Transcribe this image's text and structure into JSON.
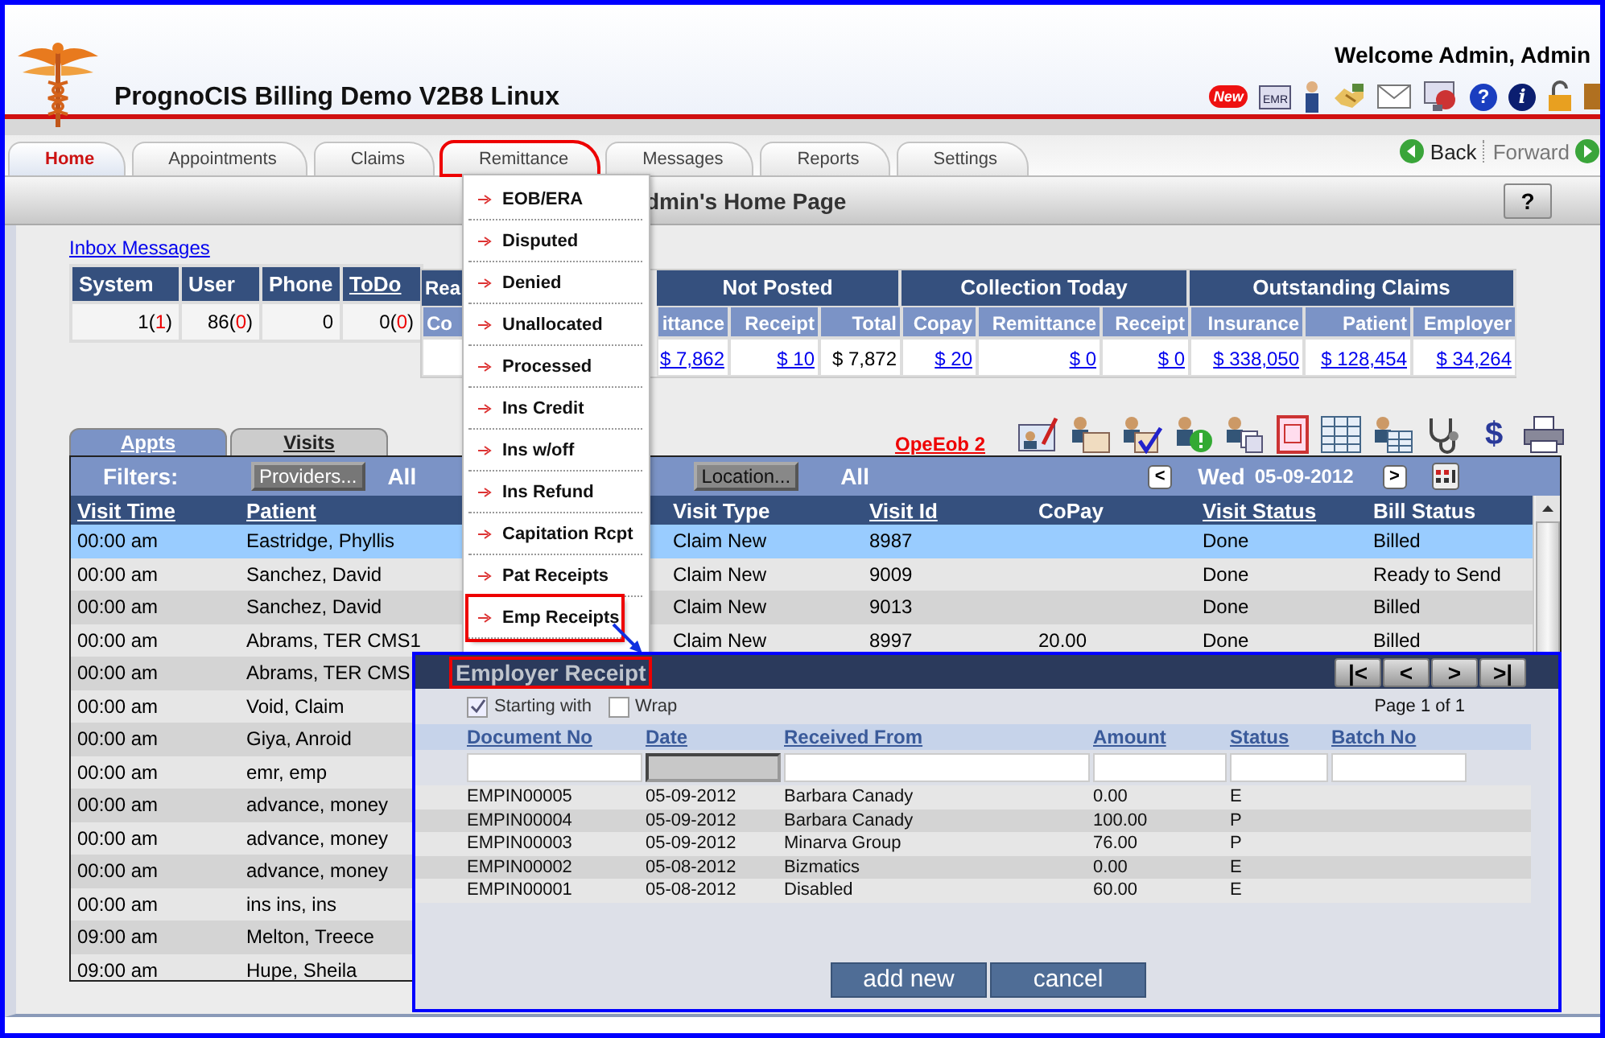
{
  "app": {
    "title": "PrognoCIS Billing Demo V2B8 Linux",
    "welcome": "Welcome Admin, Admin"
  },
  "header_icons": [
    {
      "kind": "badge",
      "text": "New"
    },
    {
      "kind": "emr",
      "text": "EMR"
    },
    {
      "kind": "person"
    },
    {
      "kind": "hands"
    },
    {
      "kind": "mail"
    },
    {
      "kind": "monitor"
    },
    {
      "kind": "help",
      "text": "?"
    },
    {
      "kind": "info",
      "text": "i"
    },
    {
      "kind": "lock"
    },
    {
      "kind": "exit"
    }
  ],
  "tabs": [
    {
      "label": "Home",
      "selected": true,
      "highlighted": false
    },
    {
      "label": "Appointments",
      "selected": false,
      "highlighted": false
    },
    {
      "label": "Claims",
      "selected": false,
      "highlighted": false
    },
    {
      "label": "Remittance",
      "selected": false,
      "highlighted": true
    },
    {
      "label": "Messages",
      "selected": false,
      "highlighted": false
    },
    {
      "label": "Reports",
      "selected": false,
      "highlighted": false
    },
    {
      "label": "Settings",
      "selected": false,
      "highlighted": false
    }
  ],
  "nav": {
    "back": "Back",
    "forward": "Forward"
  },
  "page_title": "dmin's Home Page",
  "help": "?",
  "inbox": {
    "link": "Inbox Messages",
    "columns": [
      {
        "label": "System",
        "link": false
      },
      {
        "label": "User",
        "link": false
      },
      {
        "label": "Phone",
        "link": false
      },
      {
        "label": "ToDo",
        "link": true
      }
    ],
    "values": [
      [
        {
          "text": "1(",
          "red": false
        },
        {
          "text": "1",
          "red": true
        },
        {
          "text": ")",
          "red": false
        }
      ],
      [
        {
          "text": "86(",
          "red": false
        },
        {
          "text": "0",
          "red": true
        },
        {
          "text": ")",
          "red": false
        }
      ],
      [
        {
          "text": "0",
          "red": false
        }
      ],
      [
        {
          "text": "0(",
          "red": false
        },
        {
          "text": "0",
          "red": true
        },
        {
          "text": ")",
          "red": false
        }
      ]
    ]
  },
  "stats": [
    {
      "title": "Rea",
      "columns": [
        {
          "label": "Co"
        }
      ]
    },
    {
      "title": "Not Posted",
      "columns": [
        {
          "label": "ittance",
          "value": "$ 7,862",
          "link": true
        },
        {
          "label": "Receipt",
          "value": "$ 10",
          "link": true
        },
        {
          "label": "Total",
          "value": "$ 7,872",
          "link": false
        }
      ]
    },
    {
      "title": "Collection Today",
      "columns": [
        {
          "label": "Copay",
          "value": "$ 20",
          "link": true
        },
        {
          "label": "Remittance",
          "value": "$ 0",
          "link": true
        },
        {
          "label": "Receipt",
          "value": "$ 0",
          "link": true
        }
      ]
    },
    {
      "title": "Outstanding Claims",
      "columns": [
        {
          "label": "Insurance",
          "value": "$ 338,050",
          "link": true
        },
        {
          "label": "Patient",
          "value": "$ 128,454",
          "link": true
        },
        {
          "label": "Employer",
          "value": "$ 34,264",
          "link": true
        }
      ]
    }
  ],
  "toolbar": {
    "link": "OpeEob 2",
    "icons": [
      {
        "kind": "card-pen"
      },
      {
        "kind": "person-certificate"
      },
      {
        "kind": "person-check"
      },
      {
        "kind": "person-alert"
      },
      {
        "kind": "person-copies"
      },
      {
        "kind": "red-document"
      },
      {
        "kind": "grid-form"
      },
      {
        "kind": "person-form"
      },
      {
        "kind": "stethoscope"
      },
      {
        "kind": "dollar",
        "text": "$"
      },
      {
        "kind": "printer"
      }
    ]
  },
  "visit_tabs": [
    {
      "label": "Appts",
      "selected": true
    },
    {
      "label": "Visits",
      "selected": false
    }
  ],
  "filters": {
    "label": "Filters:",
    "providers": "Providers...",
    "providers_value": "All",
    "location": "Location...",
    "location_value": "All",
    "prev": "<",
    "day": "Wed",
    "date": "05-09-2012",
    "next": ">"
  },
  "visit_columns": [
    {
      "label": "Visit Time",
      "link": true
    },
    {
      "label": "Patient",
      "link": true
    },
    {
      "label": "Visit Type",
      "link": false
    },
    {
      "label": "Visit Id",
      "link": true
    },
    {
      "label": "CoPay",
      "link": false
    },
    {
      "label": "Visit Status",
      "link": true
    },
    {
      "label": "Bill Status",
      "link": false
    }
  ],
  "visits": [
    {
      "time": "00:00 am",
      "patient": "Eastridge, Phyllis",
      "type": "Claim New",
      "id": "8987",
      "visit_status": "Done",
      "bill_status": "Billed",
      "selected": true
    },
    {
      "time": "00:00 am",
      "patient": "Sanchez, David",
      "type": "Claim New",
      "id": "9009",
      "visit_status": "Done",
      "bill_status": "Ready to Send",
      "selected": false
    },
    {
      "time": "00:00 am",
      "patient": "Sanchez, David",
      "type": "Claim New",
      "id": "9013",
      "visit_status": "Done",
      "bill_status": "Billed",
      "selected": false
    },
    {
      "time": "00:00 am",
      "patient": "Abrams, TER CMS1",
      "type": "Claim New",
      "id": "8997",
      "copay": "20.00",
      "visit_status": "Done",
      "bill_status": "Billed",
      "selected": false
    },
    {
      "time": "00:00 am",
      "patient": "Abrams, TER CMS",
      "selected": false
    },
    {
      "time": "00:00 am",
      "patient": "Void, Claim",
      "selected": false
    },
    {
      "time": "00:00 am",
      "patient": "Giya, Anroid",
      "selected": false
    },
    {
      "time": "00:00 am",
      "patient": "emr, emp",
      "selected": false
    },
    {
      "time": "00:00 am",
      "patient": "advance, money",
      "selected": false
    },
    {
      "time": "00:00 am",
      "patient": "advance, money",
      "selected": false
    },
    {
      "time": "00:00 am",
      "patient": "advance, money",
      "selected": false
    },
    {
      "time": "00:00 am",
      "patient": "ins ins, ins",
      "selected": false
    },
    {
      "time": "09:00 am",
      "patient": "Melton, Treece",
      "selected": false
    },
    {
      "time": "09:00 am",
      "patient": "Hupe, Sheila",
      "selected": false
    }
  ],
  "menu": [
    {
      "label": "EOB/ERA",
      "highlighted": false
    },
    {
      "label": "Disputed",
      "highlighted": false
    },
    {
      "label": "Denied",
      "highlighted": false
    },
    {
      "label": "Unallocated",
      "highlighted": false
    },
    {
      "label": "Processed",
      "highlighted": false
    },
    {
      "label": "Ins Credit",
      "highlighted": false
    },
    {
      "label": "Ins w/off",
      "highlighted": false
    },
    {
      "label": "Ins Refund",
      "highlighted": false
    },
    {
      "label": "Capitation Rcpt",
      "highlighted": false
    },
    {
      "label": "Pat Receipts",
      "highlighted": false
    },
    {
      "label": "Emp Receipts",
      "highlighted": true
    }
  ],
  "dialog": {
    "title": "Employer Receipt",
    "pager": [
      "|<",
      "<",
      ">",
      ">|"
    ],
    "options": [
      {
        "label": "Starting with",
        "checked": true
      },
      {
        "label": "Wrap",
        "checked": false
      }
    ],
    "page": "Page 1 of 1",
    "columns": [
      {
        "label": "Document No",
        "filter_disabled": false
      },
      {
        "label": "Date",
        "filter_disabled": true
      },
      {
        "label": "Received From",
        "filter_disabled": false
      },
      {
        "label": "Amount",
        "filter_disabled": false
      },
      {
        "label": "Status",
        "filter_disabled": false
      },
      {
        "label": "Batch No",
        "filter_disabled": false
      }
    ],
    "rows": [
      {
        "doc": "EMPIN00005",
        "date": "05-09-2012",
        "from": "Barbara Canady",
        "amount": "0.00",
        "status": "E"
      },
      {
        "doc": "EMPIN00004",
        "date": "05-09-2012",
        "from": "Barbara Canady",
        "amount": "100.00",
        "status": "P"
      },
      {
        "doc": "EMPIN00003",
        "date": "05-09-2012",
        "from": "Minarva Group",
        "amount": "76.00",
        "status": "P"
      },
      {
        "doc": "EMPIN00002",
        "date": "05-08-2012",
        "from": "Bizmatics",
        "amount": "0.00",
        "status": "E"
      },
      {
        "doc": "EMPIN00001",
        "date": "05-08-2012",
        "from": "Disabled",
        "amount": "60.00",
        "status": "E"
      }
    ],
    "buttons": [
      "add new",
      "cancel"
    ]
  }
}
